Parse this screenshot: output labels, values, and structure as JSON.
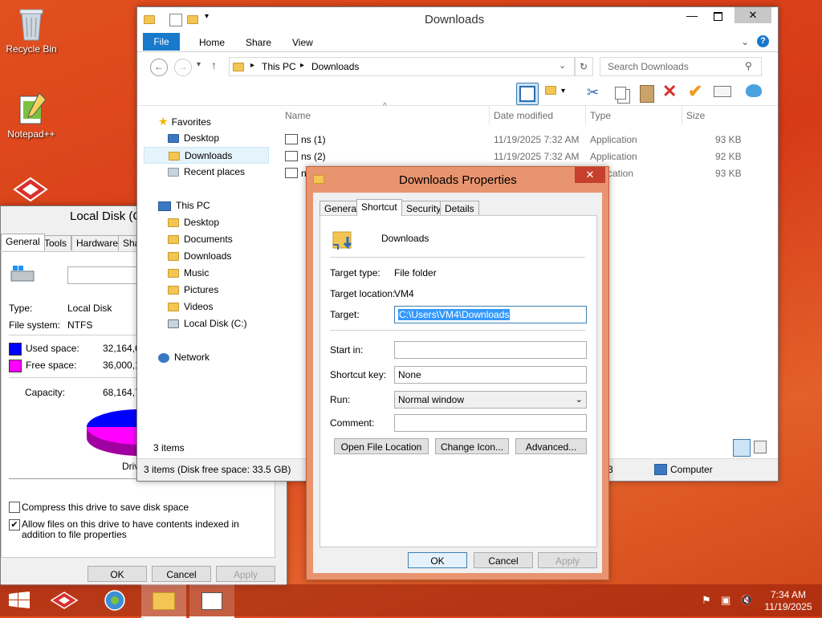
{
  "desktop": {
    "icons": [
      {
        "label": "Recycle Bin",
        "icon": "recycle-bin-icon"
      },
      {
        "label": "Notepad++",
        "icon": "notepad-plus-plus-icon"
      }
    ]
  },
  "disk_props": {
    "title": "Local Disk (C",
    "tabs": [
      "General",
      "Tools",
      "Hardware",
      "Sha"
    ],
    "type_label": "Type:",
    "type_value": "Local Disk",
    "fs_label": "File system:",
    "fs_value": "NTFS",
    "used_label": "Used space:",
    "used_value": "32,164,6",
    "free_label": "Free space:",
    "free_value": "36,000,1",
    "capacity_label": "Capacity:",
    "capacity_value": "68,164,7",
    "drive_label": "Driv",
    "compress_label": "Compress this drive to save disk space",
    "index_label": "Allow files on this drive to have contents indexed in addition to file properties",
    "ok": "OK",
    "cancel": "Cancel",
    "apply": "Apply",
    "used_color": "#0000ff",
    "free_color": "#ff00ff"
  },
  "explorer": {
    "title": "Downloads",
    "ribbon_tabs": [
      "File",
      "Home",
      "Share",
      "View"
    ],
    "breadcrumb": [
      "This PC",
      "Downloads"
    ],
    "search_placeholder": "Search Downloads",
    "columns": [
      "Name",
      "Date modified",
      "Type",
      "Size"
    ],
    "rows": [
      {
        "name": "ns (1)",
        "date": "11/19/2025 7:32 AM",
        "type": "Application",
        "size": "93 KB"
      },
      {
        "name": "ns (2)",
        "date": "11/19/2025 7:32 AM",
        "type": "Application",
        "size": "92 KB"
      },
      {
        "name": "n",
        "date": "",
        "type": "plication",
        "size": "93 KB"
      }
    ],
    "nav": {
      "favorites": "Favorites",
      "fav_items": [
        "Desktop",
        "Downloads",
        "Recent places"
      ],
      "thispc": "This PC",
      "pc_items": [
        "Desktop",
        "Documents",
        "Downloads",
        "Music",
        "Pictures",
        "Videos",
        "Local Disk (C:)"
      ],
      "network": "Network"
    },
    "status_count": "3 items",
    "status_bar": "3 items (Disk free space: 33.5 GB)",
    "status_right_num": "3",
    "status_computer": "Computer"
  },
  "props": {
    "title": "Downloads Properties",
    "tabs": [
      "General",
      "Shortcut",
      "Security",
      "Details"
    ],
    "name": "Downloads",
    "target_type_label": "Target type:",
    "target_type": "File folder",
    "target_location_label": "Target location:",
    "target_location": "VM4",
    "target_label": "Target:",
    "target": "C:\\Users\\VM4\\Downloads",
    "start_in_label": "Start in:",
    "start_in": "",
    "shortcut_key_label": "Shortcut key:",
    "shortcut_key": "None",
    "run_label": "Run:",
    "run": "Normal window",
    "comment_label": "Comment:",
    "comment": "",
    "open_location": "Open File Location",
    "change_icon": "Change Icon...",
    "advanced": "Advanced...",
    "ok": "OK",
    "cancel": "Cancel",
    "apply": "Apply"
  },
  "taskbar": {
    "time": "7:34 AM",
    "date": "11/19/2025"
  }
}
